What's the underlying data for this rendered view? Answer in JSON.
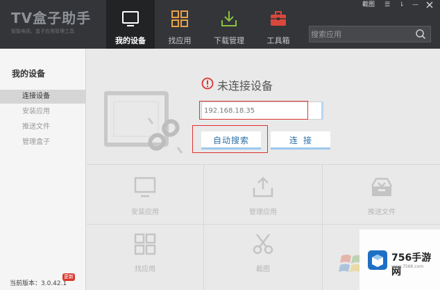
{
  "app": {
    "title": "TV盒子助手",
    "subtitle": "智能电视、盒子应用管理工具"
  },
  "window_controls": [
    "截图",
    "☰",
    "⇂",
    "—"
  ],
  "nav": [
    {
      "label": "我的设备",
      "icon": "tv-icon",
      "active": true
    },
    {
      "label": "找应用",
      "icon": "grid-icon",
      "active": false
    },
    {
      "label": "下载管理",
      "icon": "download-icon",
      "active": false
    },
    {
      "label": "工具箱",
      "icon": "toolbox-icon",
      "active": false
    }
  ],
  "search": {
    "placeholder": "搜索应用"
  },
  "sidebar": {
    "title": "我的设备",
    "items": [
      {
        "label": "连接设备",
        "active": true
      },
      {
        "label": "安装应用",
        "active": false
      },
      {
        "label": "推送文件",
        "active": false
      },
      {
        "label": "管理盒子",
        "active": false
      }
    ],
    "version": "当前版本：3.0.42.1",
    "update_badge": "更新"
  },
  "connection": {
    "status_text": "未连接设备",
    "ip_value": "192.168.18.35",
    "auto_search_label": "自动搜索",
    "connect_label": "连接"
  },
  "functions": [
    {
      "label": "安装应用",
      "icon": "tv-install-icon"
    },
    {
      "label": "管理应用",
      "icon": "upload-icon"
    },
    {
      "label": "推送文件",
      "icon": "inbox-icon"
    },
    {
      "label": "找应用",
      "icon": "grid-icon"
    },
    {
      "label": "截图",
      "icon": "scissors-icon"
    }
  ],
  "watermark": {
    "title": "756手游网",
    "url": "www.7566.com"
  },
  "colors": {
    "topbar": "#333538",
    "accent_orange": "#e8a34a",
    "download_green": "#8ec13f",
    "toolbox_red": "#d9473c",
    "highlight_red": "#dd3333",
    "button_blue": "#2d6fa8"
  }
}
